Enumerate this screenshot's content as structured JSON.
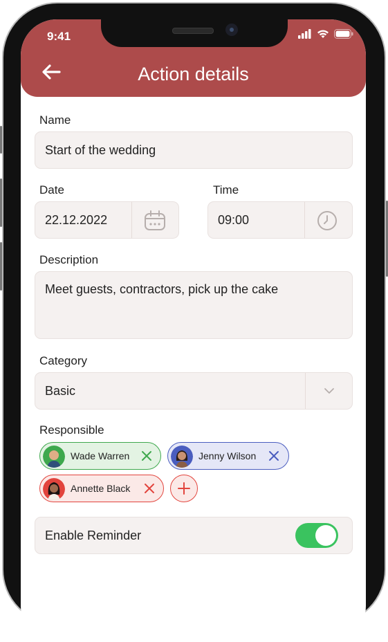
{
  "status_bar": {
    "time": "9:41"
  },
  "header": {
    "title": "Action details"
  },
  "form": {
    "name_label": "Name",
    "name_value": "Start of the wedding",
    "date_label": "Date",
    "date_value": "22.12.2022",
    "time_label": "Time",
    "time_value": "09:00",
    "description_label": "Description",
    "description_value": "Meet guests, contractors, pick up the cake",
    "category_label": "Category",
    "category_value": "Basic",
    "responsible_label": "Responsible",
    "responsible": [
      {
        "name": "Wade Warren",
        "color": "#3ea84d",
        "bg": "#e3f3e3"
      },
      {
        "name": "Jenny Wilson",
        "color": "#4a5dbf",
        "bg": "#e5e7f7"
      },
      {
        "name": "Annette Black",
        "color": "#e2443d",
        "bg": "#fbe9e7"
      }
    ],
    "reminder_label": "Enable Reminder",
    "reminder_enabled": true
  },
  "colors": {
    "header": "#ad4b4b",
    "toggle_on": "#3ac35f",
    "field_bg": "#f5f1f0"
  },
  "icons": [
    "back-arrow-icon",
    "calendar-icon",
    "clock-icon",
    "chevron-down-icon",
    "close-icon",
    "plus-icon",
    "signal-icon",
    "wifi-icon",
    "battery-icon"
  ]
}
